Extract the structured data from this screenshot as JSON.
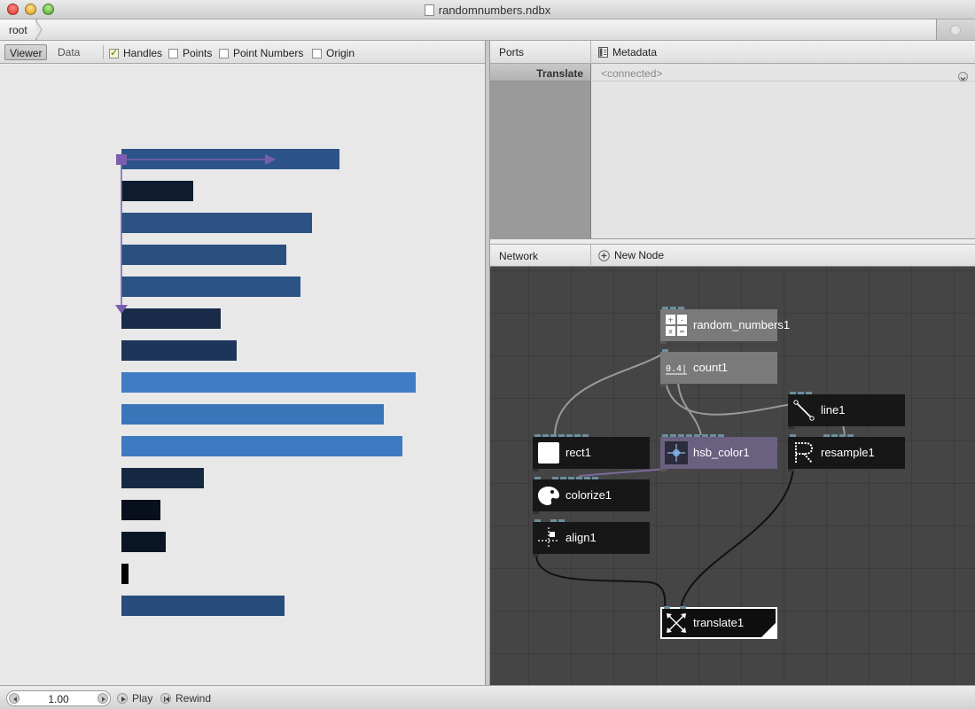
{
  "window": {
    "title": "randomnumbers.ndbx"
  },
  "breadcrumb": {
    "root_label": "root"
  },
  "viewer_toolbar": {
    "tabs": [
      {
        "label": "Viewer",
        "active": true
      },
      {
        "label": "Data",
        "active": false
      }
    ],
    "options": [
      {
        "label": "Handles",
        "checked": true
      },
      {
        "label": "Points",
        "checked": false
      },
      {
        "label": "Point Numbers",
        "checked": false
      },
      {
        "label": "Origin",
        "checked": false
      }
    ]
  },
  "viewer": {
    "bar_values": [
      246,
      81,
      215,
      186,
      202,
      112,
      130,
      332,
      296,
      317,
      93,
      44,
      50,
      8,
      184
    ],
    "bar_colors": [
      "#2d5488",
      "#0f1c2f",
      "#2b5283",
      "#29507e",
      "#2b5385",
      "#182c4a",
      "#1d355a",
      "#3f7cc5",
      "#3b75b9",
      "#3e7ac2",
      "#162943",
      "#07101c",
      "#0b1624",
      "#000000",
      "#284d7c"
    ],
    "handle_color": "#7b5fae"
  },
  "ports_panel": {
    "title": "Ports",
    "metadata_label": "Metadata",
    "rows": [
      {
        "label": "Translate",
        "value": "<connected>"
      }
    ]
  },
  "network_panel": {
    "title": "Network",
    "new_node_label": "New Node",
    "nodes": {
      "random_numbers": "random_numbers1",
      "count": "count1",
      "count_icon_text": "0.4|1",
      "line": "line1",
      "rect": "rect1",
      "hsb_color": "hsb_color1",
      "resample": "resample1",
      "colorize": "colorize1",
      "align": "align1",
      "translate": "translate1"
    }
  },
  "bottom_bar": {
    "frame_value": "1.00",
    "play_label": "Play",
    "rewind_label": "Rewind"
  }
}
